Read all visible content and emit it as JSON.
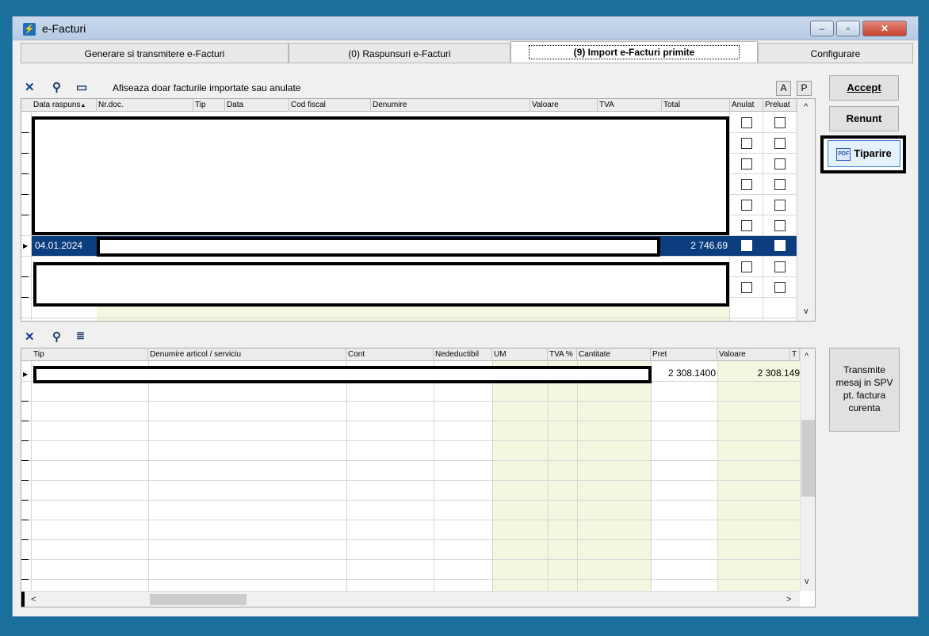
{
  "window": {
    "title": "e-Facturi",
    "app_icon": "bolt-icon",
    "controls": {
      "minimize": "–",
      "maximize": "▫",
      "close": "✕"
    }
  },
  "tabs": [
    {
      "label": "Generare si transmitere e-Facturi",
      "active": false
    },
    {
      "label": "(0) Raspunsuri e-Facturi",
      "active": false
    },
    {
      "label": "(9) Import e-Facturi primite",
      "active": true
    },
    {
      "label": "Configurare",
      "active": false
    }
  ],
  "top_toolbar": {
    "icons": [
      "excel-icon",
      "binoculars-icon",
      "folder-icon"
    ],
    "filter_label": "Afiseaza doar facturile importate sau anulate",
    "btn_a": "A",
    "btn_p": "P"
  },
  "invoices_grid": {
    "columns": [
      "Data raspuns",
      "Nr.doc.",
      "Tip",
      "Data",
      "Cod fiscal",
      "Denumire",
      "Valoare",
      "TVA",
      "Total",
      "Anulat",
      "Preluat"
    ],
    "sort_indicator": "▲",
    "selected_row": {
      "date": "04.01.2024",
      "total": "2 746.69"
    }
  },
  "side_buttons": {
    "accept": "Accept",
    "cancel": "Renunt",
    "print": "Tiparire",
    "print_icon": "pdf-icon",
    "transmit": "Transmite mesaj in SPV pt. factura curenta"
  },
  "bottom_toolbar": {
    "icons": [
      "excel-icon",
      "binoculars-icon",
      "list-icon"
    ]
  },
  "items_grid": {
    "columns": [
      "Tip",
      "Denumire articol / serviciu",
      "Cont",
      "Nedeductibil",
      "UM",
      "TVA %",
      "Cantitate",
      "Pret",
      "Valoare",
      "T"
    ],
    "row": {
      "pret": "2 308.1400",
      "valoare": "2 308.149"
    }
  },
  "scroll": {
    "up": "^",
    "down": "v",
    "left": "<",
    "right": ">"
  }
}
